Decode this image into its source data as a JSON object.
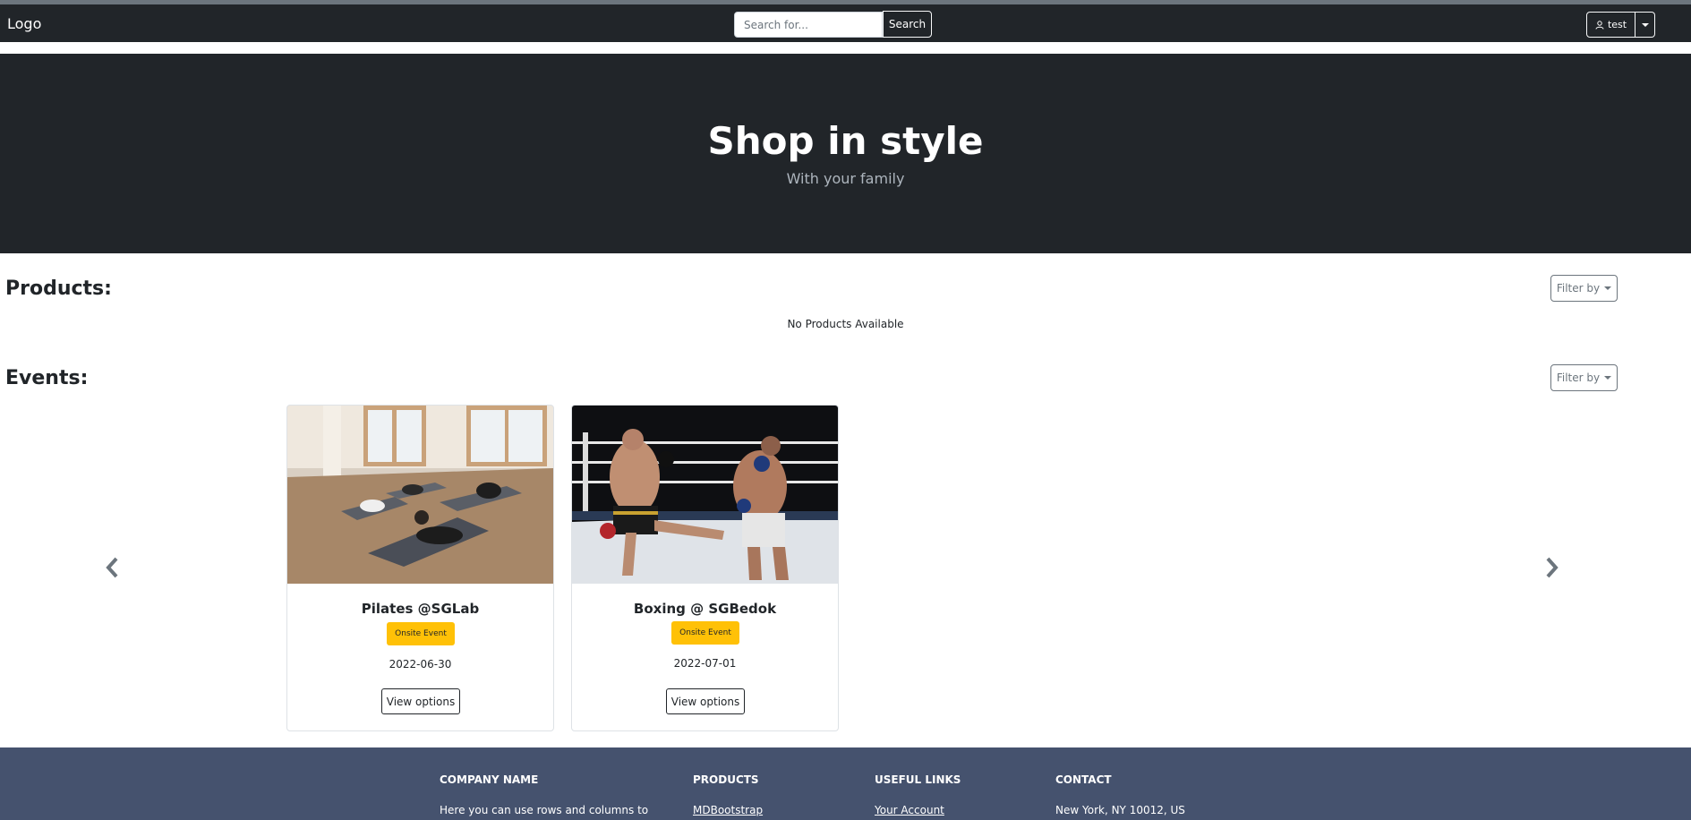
{
  "navbar": {
    "logo": "Logo",
    "search_placeholder": "Search for...",
    "search_button": "Search",
    "user_label": "test"
  },
  "hero": {
    "title": "Shop in style",
    "subtitle": "With your family"
  },
  "products": {
    "heading": "Products:",
    "filter_label": "Filter by",
    "empty_message": "No Products Available"
  },
  "events": {
    "heading": "Events:",
    "filter_label": "Filter by",
    "cards": [
      {
        "title": "Pilates @SGLab",
        "badge": "Onsite Event",
        "date": "2022-06-30",
        "button": "View options"
      },
      {
        "title": "Boxing @ SGBedok",
        "badge": "Onsite Event",
        "date": "2022-07-01",
        "button": "View options"
      }
    ]
  },
  "footer": {
    "company_heading": "COMPANY NAME",
    "company_text": "Here you can use rows and columns to",
    "products_heading": "PRODUCTS",
    "products_link": "MDBootstrap",
    "links_heading": "USEFUL LINKS",
    "links_link": "Your Account",
    "contact_heading": "CONTACT",
    "contact_address": "New York, NY 10012, US"
  },
  "colors": {
    "navbar_bg": "#212529",
    "badge": "#ffc107",
    "footer_bg": "#45526e"
  }
}
